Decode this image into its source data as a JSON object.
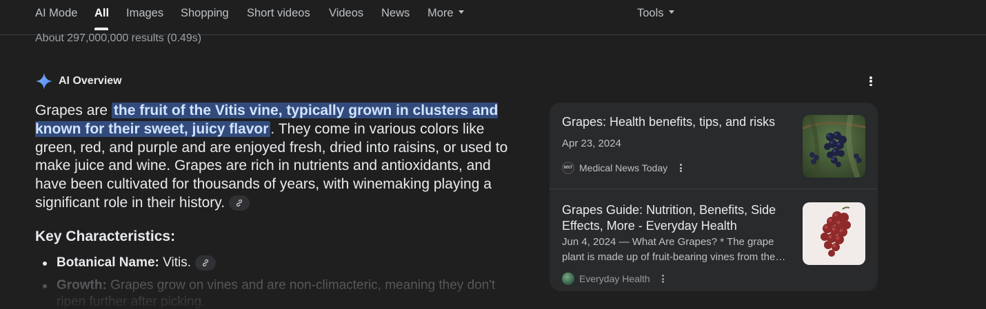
{
  "tabs": [
    {
      "label": "AI Mode"
    },
    {
      "label": "All"
    },
    {
      "label": "Images"
    },
    {
      "label": "Shopping"
    },
    {
      "label": "Short videos"
    },
    {
      "label": "Videos"
    },
    {
      "label": "News"
    },
    {
      "label": "More"
    },
    {
      "label": "Tools"
    }
  ],
  "active_tab": "All",
  "results_count": "About 297,000,000 results (0.49s)",
  "ai_overview": {
    "title": "AI Overview",
    "icon": "sparkle-icon",
    "intro_prefix": "Grapes are ",
    "intro_highlight": "the fruit of the Vitis vine, typically grown in clusters and known for their sweet, juicy flavor",
    "intro_rest": ". They come in various colors like green, red, and purple and are enjoyed fresh, dried into raisins, or used to make juice and wine. Grapes are rich in nutrients and antioxidants, and have been cultivated for thousands of years, with winemaking playing a significant role in their history.",
    "key_heading": "Key Characteristics:",
    "bullets": [
      {
        "label": "Botanical Name:",
        "text": " Vitis."
      },
      {
        "label": "Growth:",
        "text": " Grapes grow on vines and are non-climacteric, meaning they don't ripen further after picking."
      }
    ]
  },
  "sources": [
    {
      "title": "Grapes: Health benefits, tips, and risks",
      "date": "Apr 23, 2024",
      "site": "Medical News Today",
      "favicon_text": "MNT",
      "thumb": "grapes-vineyard-image"
    },
    {
      "title": "Grapes Guide: Nutrition, Benefits, Side Effects, More - Everyday Health",
      "snippet": "Jun 4, 2024 — What Are Grapes? * The grape plant is made up of fruit-bearing vines from the…",
      "site": "Everyday Health",
      "thumb": "red-grapes-bunch-image"
    }
  ],
  "colors": {
    "background": "#1f1f1f",
    "highlight_bg": "#324b7c",
    "card_bg": "#282a2c",
    "accent_blue": "#4285f4"
  }
}
